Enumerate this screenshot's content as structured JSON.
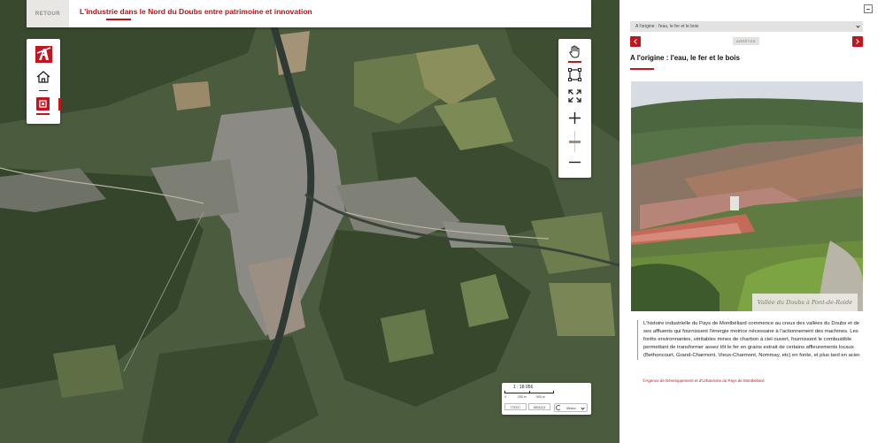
{
  "header": {
    "back_label": "RETOUR",
    "title": "L'industrie dans le Nord du Doubs entre patrimoine et innovation"
  },
  "left_panel": {
    "logo_icon": "agency-logo-icon",
    "home_icon": "home-icon",
    "layer_icon": "layers-icon"
  },
  "map_tools": {
    "pan_icon": "hand-icon",
    "select_icon": "bounding-box-icon",
    "fullscreen_icon": "expand-icon",
    "zoom_in_icon": "plus-icon",
    "zoom_out_icon": "minus-icon"
  },
  "scale": {
    "ratio": "1 : 18 056",
    "bar_labels": [
      "0",
      "250 m",
      "500 m"
    ],
    "coord_x": "737517",
    "coord_y": "6803124",
    "unit": "Mètres"
  },
  "sidebar": {
    "chapter_selected": "A l'origine : l'eau, le fer et le bois",
    "stop_label": "ARRÊTER",
    "section_title": "A l'origine : l'eau, le fer et le bois",
    "photo_caption": "Vallée du Doubs à Pont-de-Roide",
    "body": "L'histoire industrielle du Pays de Montbéliard commence au creux des vallées du Doubs et de ses affluents qui fournissent l'énergie motrice nécessaire à l'actionnement des machines. Les forêts environnantes, véritables mines de charbon à ciel ouvert, fournissent le combustible permettant de transformer assez tôt le fer en grains extrait de certains affleurements locaux (Bethoncourt, Grand-Charmont, Vieux-Charmont, Nommay, etc) en fonte, et plus tard en acier.",
    "credit": "©Agence de Développement et d'Urbanisme du Pays de Montbéliard"
  },
  "colors": {
    "accent": "#c1161d",
    "title_red": "#b3161b",
    "panel_grey": "#e4e2e0"
  }
}
